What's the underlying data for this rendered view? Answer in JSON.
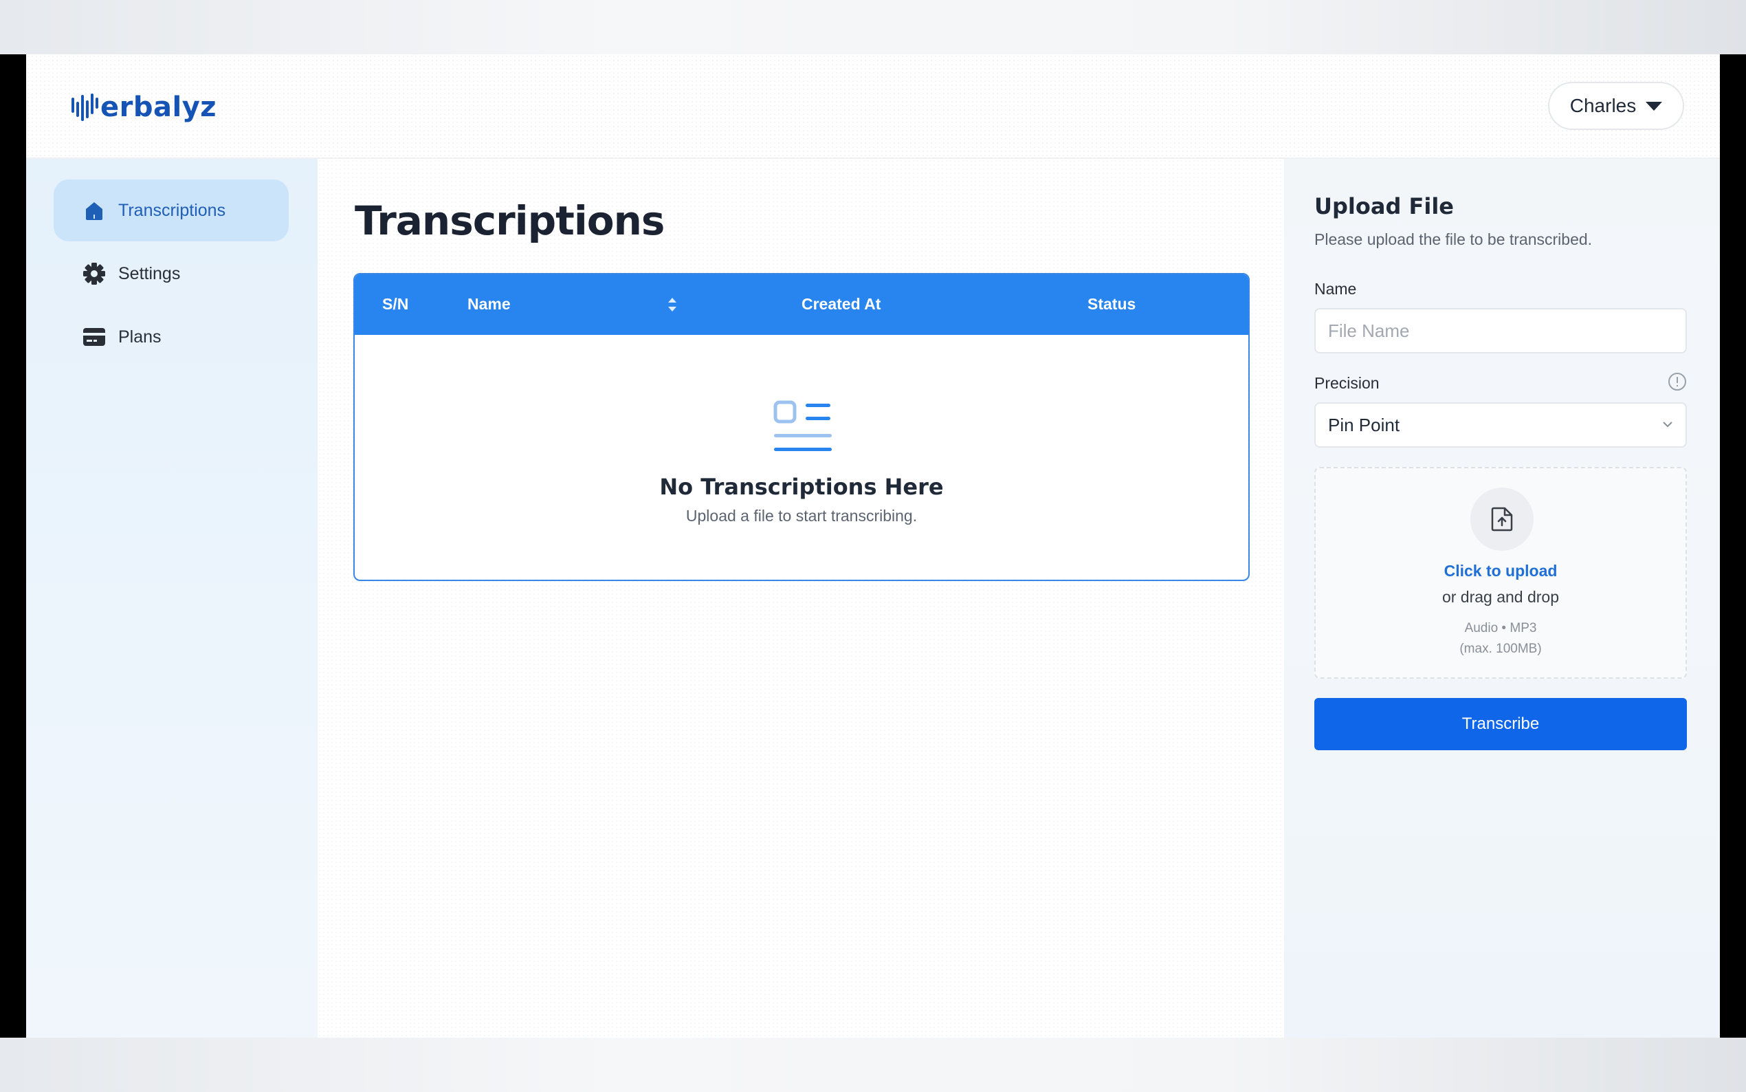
{
  "header": {
    "logo_text": "erbalyz",
    "user_name": "Charles"
  },
  "sidebar": {
    "items": [
      {
        "label": "Transcriptions",
        "icon": "home-icon",
        "active": true
      },
      {
        "label": "Settings",
        "icon": "gear-icon",
        "active": false
      },
      {
        "label": "Plans",
        "icon": "credit-card-icon",
        "active": false
      }
    ]
  },
  "main": {
    "title": "Transcriptions",
    "table": {
      "columns": [
        "S/N",
        "Name",
        "Created At",
        "Status"
      ],
      "rows": []
    },
    "empty_state": {
      "title": "No Transcriptions Here",
      "subtitle": "Upload a file to start transcribing."
    }
  },
  "upload_panel": {
    "title": "Upload File",
    "subtitle": "Please upload the file to be transcribed.",
    "name_label": "Name",
    "name_placeholder": "File Name",
    "name_value": "",
    "precision_label": "Precision",
    "precision_value": "Pin Point",
    "dropzone": {
      "click_text": "Click to upload",
      "drag_text": "or drag and drop",
      "format_text": "Audio • MP3",
      "max_text": "(max. 100MB)"
    },
    "submit_label": "Transcribe"
  },
  "colors": {
    "brand": "#1553b5",
    "table_header": "#2885f0",
    "primary_button": "#1066e8",
    "active_nav_bg": "#cce4fa"
  }
}
